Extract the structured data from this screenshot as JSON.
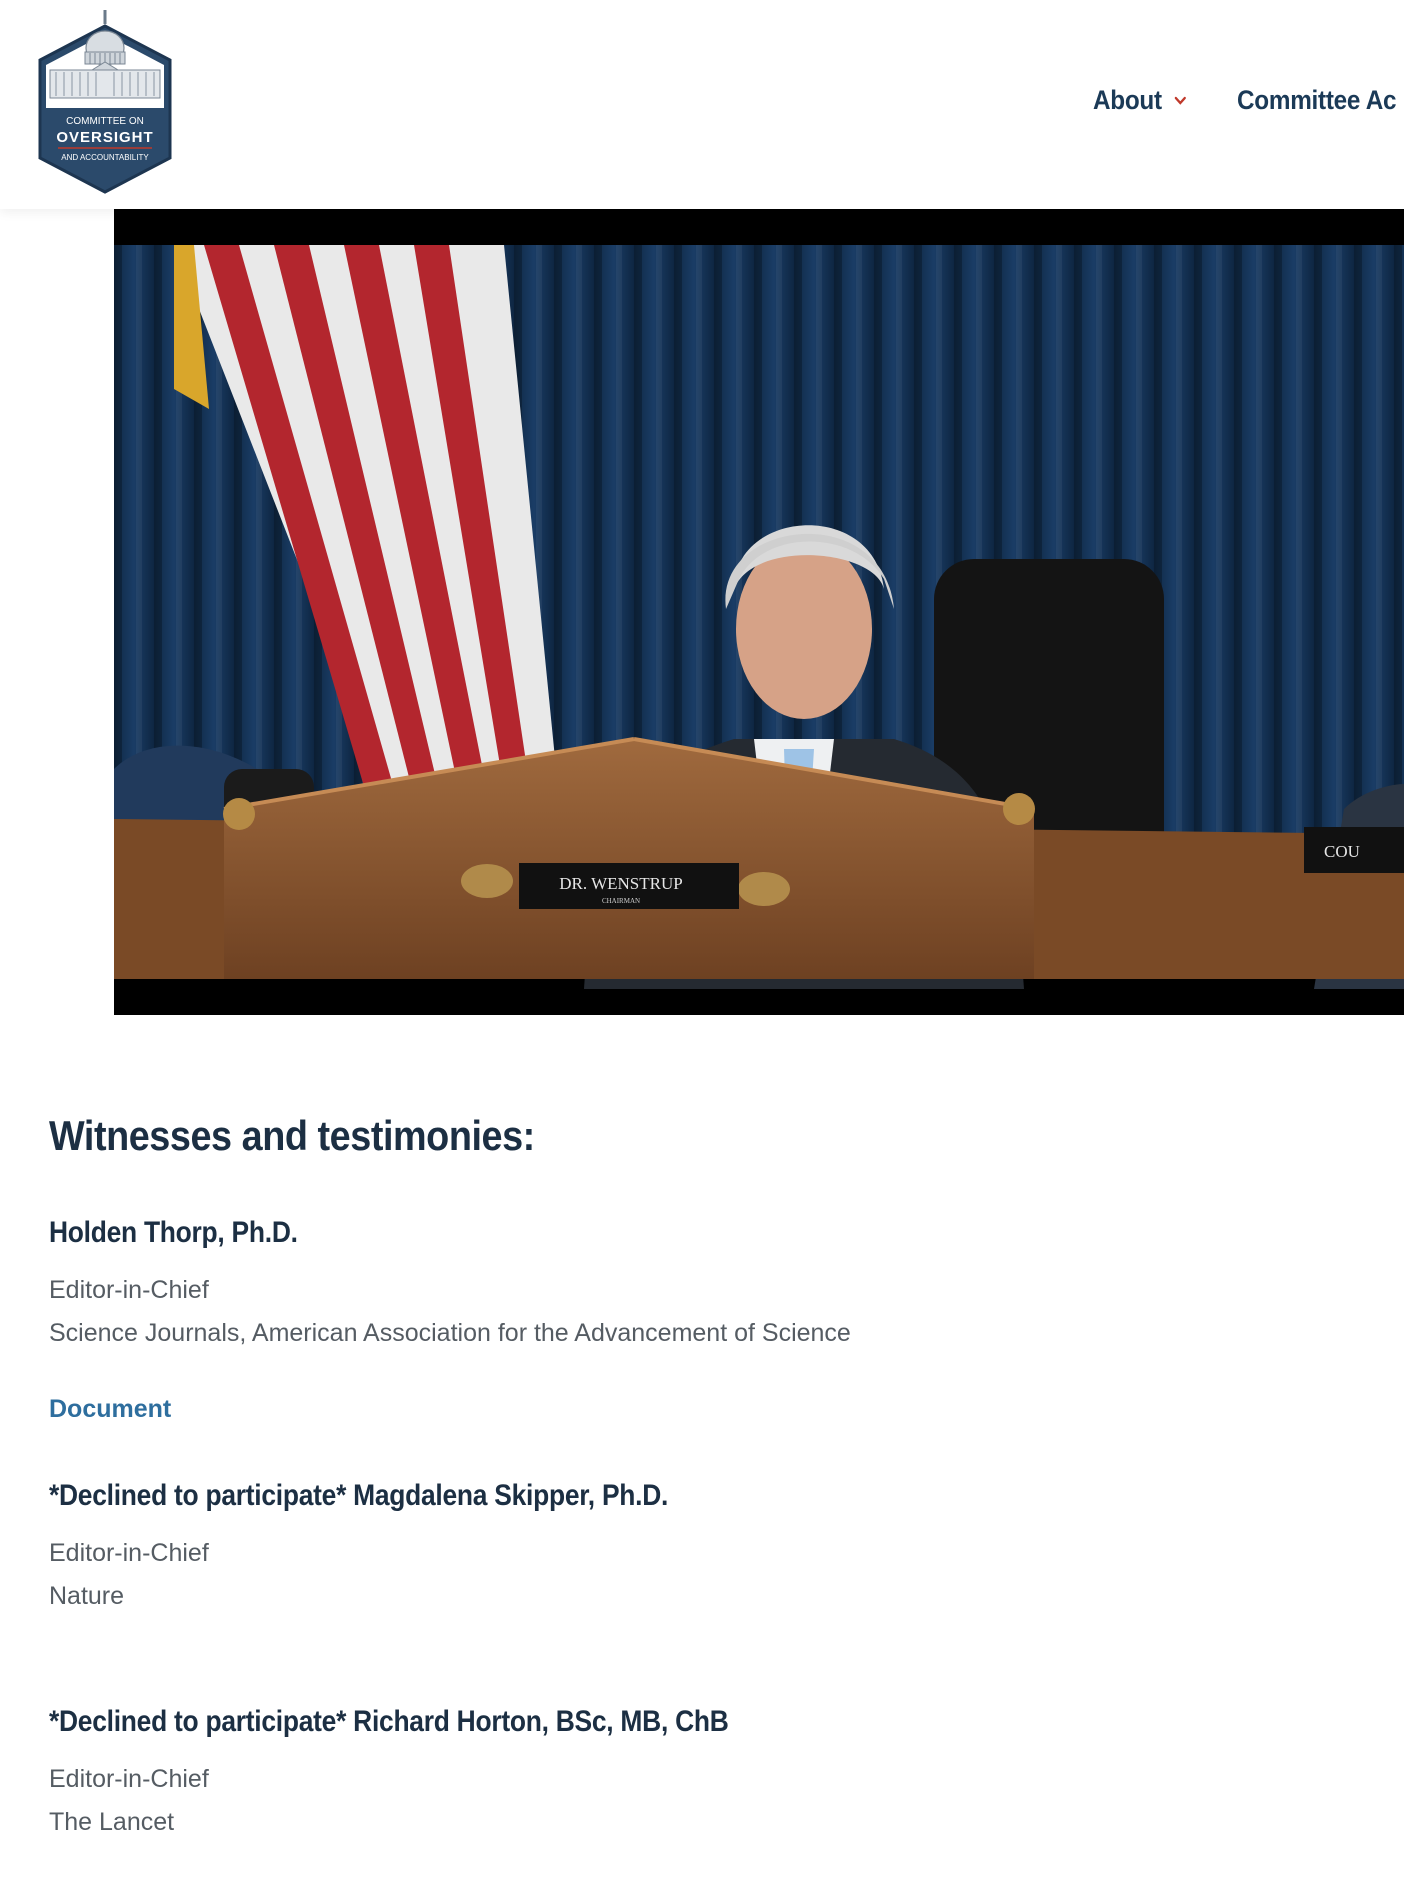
{
  "header": {
    "logo": {
      "line1": "COMMITTEE ON",
      "line2": "OVERSIGHT",
      "line3": "AND ACCOUNTABILITY"
    },
    "nav": [
      {
        "label": "About",
        "has_dropdown": true
      },
      {
        "label": "Committee Ac",
        "has_dropdown": false
      }
    ],
    "accent_color": "#c0392b"
  },
  "video": {
    "nameplate_main": "DR. WENSTRUP",
    "nameplate_sub": "CHAIRMAN",
    "nameplate_right": "COU"
  },
  "witnesses": {
    "title": "Witnesses and testimonies:",
    "items": [
      {
        "name": "Holden Thorp, Ph.D.",
        "role": "Editor-in-Chief",
        "org": "Science Journals, American Association for the Advancement of Science",
        "link": "Document"
      },
      {
        "name": "*Declined to participate* Magdalena Skipper, Ph.D.",
        "role": "Editor-in-Chief",
        "org": "Nature"
      },
      {
        "name": "*Declined to participate* Richard Horton, BSc, MB, ChB",
        "role": "Editor-in-Chief",
        "org": "The Lancet"
      }
    ]
  }
}
